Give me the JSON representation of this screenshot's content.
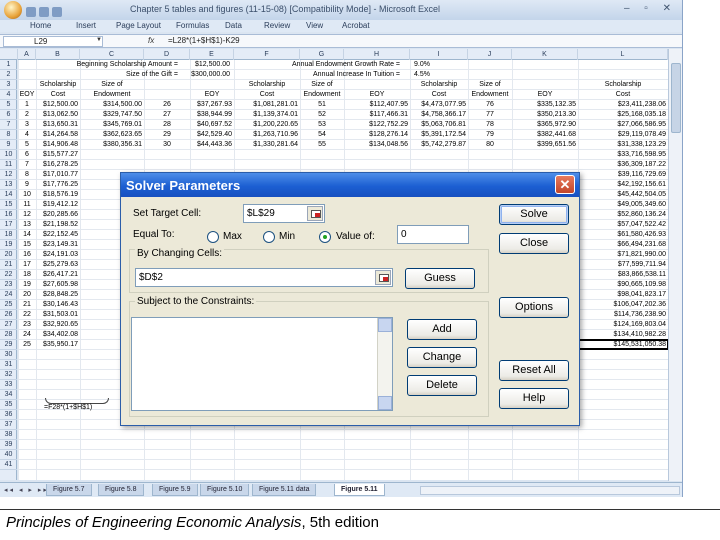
{
  "window": {
    "title": "Chapter 5 tables and figures (11-15-08)  [Compatibility Mode] - Microsoft Excel",
    "controls": "–  ▫  ✕"
  },
  "ribbon_tabs": [
    "Home",
    "Insert",
    "Page Layout",
    "Formulas",
    "Data",
    "Review",
    "View",
    "Acrobat"
  ],
  "formula_bar": {
    "name_box": "L29",
    "fx": "fx",
    "formula": "=L28*(1+$H$1)-K29"
  },
  "columns": [
    "A",
    "B",
    "C",
    "D",
    "E",
    "F",
    "G",
    "H",
    "I",
    "J",
    "K",
    "L"
  ],
  "rows": [
    "1",
    "2",
    "3",
    "4",
    "5",
    "6",
    "7",
    "8",
    "9",
    "10",
    "11",
    "12",
    "13",
    "14",
    "15",
    "16",
    "17",
    "18",
    "19",
    "20",
    "21",
    "22",
    "23",
    "24",
    "25",
    "26",
    "27",
    "28",
    "29",
    "30",
    "31",
    "32",
    "33",
    "34",
    "35",
    "36",
    "37",
    "38",
    "39",
    "40",
    "41"
  ],
  "sheet": {
    "row1_left": "Beginning Scholarship Amount =",
    "row1_left_val": "$12,500.00",
    "row1_right": "Annual Endowment Growth Rate =",
    "row1_right_val": "9.0%",
    "row2_left": "Size of the Gift =",
    "row2_left_val": "$300,000.00",
    "row2_right": "Annual Increase In Tuition =",
    "row2_right_val": "4.5%",
    "hdr_scholarship": "Scholarship",
    "hdr_cost": "Cost",
    "hdr_sizeof": "Size of",
    "hdr_endowment": "Endowment",
    "hdr_eoy": "EOY",
    "table": [
      [
        "1",
        "$12,500.00",
        "$314,500.00",
        "26",
        "$37,267.93",
        "$1,081,281.01",
        "51",
        "$112,407.95",
        "$4,473,077.95",
        "76",
        "$335,132.35",
        "$23,411,238.06"
      ],
      [
        "2",
        "$13,062.50",
        "$329,747.50",
        "27",
        "$38,944.99",
        "$1,139,374.01",
        "52",
        "$117,466.31",
        "$4,758,366.17",
        "77",
        "$350,213.30",
        "$25,168,035.18"
      ],
      [
        "3",
        "$13,650.31",
        "$345,769.01",
        "28",
        "$40,697.52",
        "$1,200,220.65",
        "53",
        "$122,752.29",
        "$5,063,706.81",
        "78",
        "$365,972.90",
        "$27,066,586.95"
      ],
      [
        "4",
        "$14,264.58",
        "$362,623.65",
        "29",
        "$42,529.40",
        "$1,263,710.96",
        "54",
        "$128,276.14",
        "$5,391,172.54",
        "79",
        "$382,441.68",
        "$29,119,078.49"
      ],
      [
        "5",
        "$14,906.48",
        "$380,356.31",
        "30",
        "$44,443.36",
        "$1,330,281.64",
        "55",
        "$134,048.56",
        "$5,742,279.87",
        "80",
        "$399,651.56",
        "$31,338,123.29"
      ],
      [
        "6",
        "$15,577.27",
        "",
        "",
        "",
        "",
        "",
        "",
        "",
        "",
        "",
        "$33,716,598.95"
      ],
      [
        "7",
        "$16,278.25",
        "",
        "",
        "",
        "",
        "",
        "",
        "",
        "",
        "",
        "$36,309,187.22"
      ],
      [
        "8",
        "$17,010.77",
        "",
        "",
        "",
        "",
        "",
        "",
        "",
        "",
        "",
        "$39,116,729.69"
      ],
      [
        "9",
        "$17,776.25",
        "",
        "",
        "",
        "",
        "",
        "",
        "",
        "",
        "",
        "$42,192,156.61"
      ],
      [
        "10",
        "$18,576.19",
        "",
        "",
        "",
        "",
        "",
        "",
        "",
        "",
        "",
        "$45,442,504.05"
      ],
      [
        "11",
        "$19,412.12",
        "",
        "",
        "",
        "",
        "",
        "",
        "",
        "",
        "",
        "$49,005,349.60"
      ],
      [
        "12",
        "$20,285.66",
        "",
        "",
        "",
        "",
        "",
        "",
        "",
        "",
        "",
        "$52,860,136.24"
      ],
      [
        "13",
        "$21,198.52",
        "",
        "",
        "",
        "",
        "",
        "",
        "",
        "",
        "",
        "$57,047,522.42"
      ],
      [
        "14",
        "$22,152.45",
        "",
        "",
        "",
        "",
        "",
        "",
        "",
        "",
        "",
        "$61,580,426.93"
      ],
      [
        "15",
        "$23,149.31",
        "",
        "",
        "",
        "",
        "",
        "",
        "",
        "",
        "",
        "$66,494,231.68"
      ],
      [
        "16",
        "$24,191.03",
        "",
        "",
        "",
        "",
        "",
        "",
        "",
        "",
        "",
        "$71,821,990.00"
      ],
      [
        "17",
        "$25,279.63",
        "",
        "",
        "",
        "",
        "",
        "",
        "",
        "",
        "",
        "$77,599,711.94"
      ],
      [
        "18",
        "$26,417.21",
        "",
        "",
        "",
        "",
        "",
        "",
        "",
        "",
        "",
        "$83,866,538.11"
      ],
      [
        "19",
        "$27,605.98",
        "",
        "",
        "",
        "",
        "",
        "",
        "",
        "",
        "",
        "$90,665,109.98"
      ],
      [
        "20",
        "$28,848.25",
        "",
        "",
        "",
        "",
        "",
        "",
        "",
        "",
        "",
        "$98,041,823.17"
      ],
      [
        "21",
        "$30,146.43",
        "",
        "",
        "",
        "",
        "",
        "",
        "",
        "",
        "",
        "$106,047,202.36"
      ],
      [
        "22",
        "$31,503.01",
        "",
        "",
        "",
        "",
        "",
        "",
        "",
        "",
        "",
        "$114,736,238.90"
      ],
      [
        "23",
        "$32,920.65",
        "",
        "",
        "",
        "",
        "",
        "",
        "",
        "",
        "",
        "$124,169,803.04"
      ],
      [
        "24",
        "$34,402.08",
        "",
        "",
        "",
        "",
        "",
        "",
        "",
        "",
        "",
        "$134,410,982.28"
      ],
      [
        "25",
        "$35,950.17",
        "",
        "",
        "",
        "",
        "",
        "",
        "",
        "",
        "",
        "$145,531,050.38"
      ]
    ],
    "annotation": "=F28*(1+$H$1)"
  },
  "sheet_tabs": [
    "Figure 5.7",
    "Figure 5.8",
    "Figure 5.9",
    "Figure 5.10",
    "Figure 5.11 data",
    "Figure 5.11"
  ],
  "active_tab": "Figure 5.11",
  "solver": {
    "title": "Solver Parameters",
    "close_glyph": "✕",
    "set_target_label": "Set Target Cell:",
    "set_target_value": "$L$29",
    "equal_to_label": "Equal To:",
    "opt_max": "Max",
    "opt_min": "Min",
    "opt_value": "Value of:",
    "value_of": "0",
    "selected_option": "Value of",
    "changing_label": "By Changing Cells:",
    "changing_value": "$D$2",
    "constraints_label": "Subject to the Constraints:",
    "btn_guess": "Guess",
    "btn_solve": "Solve",
    "btn_close": "Close",
    "btn_options": "Options",
    "btn_add": "Add",
    "btn_change": "Change",
    "btn_delete": "Delete",
    "btn_reset": "Reset All",
    "btn_help": "Help"
  },
  "footer": {
    "title": "Principles of Engineering Economic Analysis",
    "edition": ", 5th edition"
  }
}
